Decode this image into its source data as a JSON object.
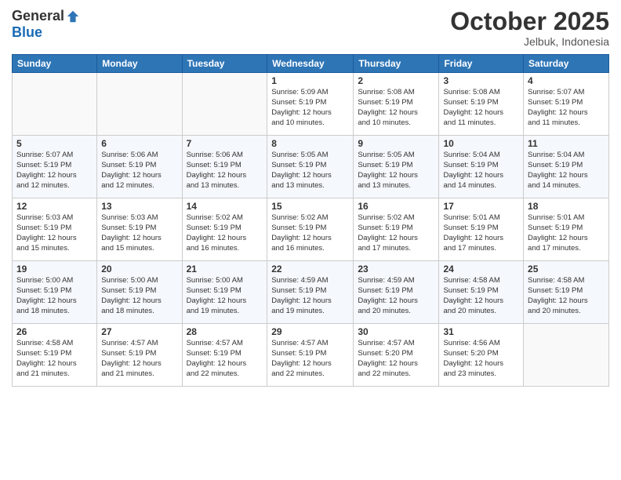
{
  "logo": {
    "general": "General",
    "blue": "Blue"
  },
  "header": {
    "month": "October 2025",
    "location": "Jelbuk, Indonesia"
  },
  "weekdays": [
    "Sunday",
    "Monday",
    "Tuesday",
    "Wednesday",
    "Thursday",
    "Friday",
    "Saturday"
  ],
  "weeks": [
    [
      {
        "day": "",
        "info": ""
      },
      {
        "day": "",
        "info": ""
      },
      {
        "day": "",
        "info": ""
      },
      {
        "day": "1",
        "info": "Sunrise: 5:09 AM\nSunset: 5:19 PM\nDaylight: 12 hours\nand 10 minutes."
      },
      {
        "day": "2",
        "info": "Sunrise: 5:08 AM\nSunset: 5:19 PM\nDaylight: 12 hours\nand 10 minutes."
      },
      {
        "day": "3",
        "info": "Sunrise: 5:08 AM\nSunset: 5:19 PM\nDaylight: 12 hours\nand 11 minutes."
      },
      {
        "day": "4",
        "info": "Sunrise: 5:07 AM\nSunset: 5:19 PM\nDaylight: 12 hours\nand 11 minutes."
      }
    ],
    [
      {
        "day": "5",
        "info": "Sunrise: 5:07 AM\nSunset: 5:19 PM\nDaylight: 12 hours\nand 12 minutes."
      },
      {
        "day": "6",
        "info": "Sunrise: 5:06 AM\nSunset: 5:19 PM\nDaylight: 12 hours\nand 12 minutes."
      },
      {
        "day": "7",
        "info": "Sunrise: 5:06 AM\nSunset: 5:19 PM\nDaylight: 12 hours\nand 13 minutes."
      },
      {
        "day": "8",
        "info": "Sunrise: 5:05 AM\nSunset: 5:19 PM\nDaylight: 12 hours\nand 13 minutes."
      },
      {
        "day": "9",
        "info": "Sunrise: 5:05 AM\nSunset: 5:19 PM\nDaylight: 12 hours\nand 13 minutes."
      },
      {
        "day": "10",
        "info": "Sunrise: 5:04 AM\nSunset: 5:19 PM\nDaylight: 12 hours\nand 14 minutes."
      },
      {
        "day": "11",
        "info": "Sunrise: 5:04 AM\nSunset: 5:19 PM\nDaylight: 12 hours\nand 14 minutes."
      }
    ],
    [
      {
        "day": "12",
        "info": "Sunrise: 5:03 AM\nSunset: 5:19 PM\nDaylight: 12 hours\nand 15 minutes."
      },
      {
        "day": "13",
        "info": "Sunrise: 5:03 AM\nSunset: 5:19 PM\nDaylight: 12 hours\nand 15 minutes."
      },
      {
        "day": "14",
        "info": "Sunrise: 5:02 AM\nSunset: 5:19 PM\nDaylight: 12 hours\nand 16 minutes."
      },
      {
        "day": "15",
        "info": "Sunrise: 5:02 AM\nSunset: 5:19 PM\nDaylight: 12 hours\nand 16 minutes."
      },
      {
        "day": "16",
        "info": "Sunrise: 5:02 AM\nSunset: 5:19 PM\nDaylight: 12 hours\nand 17 minutes."
      },
      {
        "day": "17",
        "info": "Sunrise: 5:01 AM\nSunset: 5:19 PM\nDaylight: 12 hours\nand 17 minutes."
      },
      {
        "day": "18",
        "info": "Sunrise: 5:01 AM\nSunset: 5:19 PM\nDaylight: 12 hours\nand 17 minutes."
      }
    ],
    [
      {
        "day": "19",
        "info": "Sunrise: 5:00 AM\nSunset: 5:19 PM\nDaylight: 12 hours\nand 18 minutes."
      },
      {
        "day": "20",
        "info": "Sunrise: 5:00 AM\nSunset: 5:19 PM\nDaylight: 12 hours\nand 18 minutes."
      },
      {
        "day": "21",
        "info": "Sunrise: 5:00 AM\nSunset: 5:19 PM\nDaylight: 12 hours\nand 19 minutes."
      },
      {
        "day": "22",
        "info": "Sunrise: 4:59 AM\nSunset: 5:19 PM\nDaylight: 12 hours\nand 19 minutes."
      },
      {
        "day": "23",
        "info": "Sunrise: 4:59 AM\nSunset: 5:19 PM\nDaylight: 12 hours\nand 20 minutes."
      },
      {
        "day": "24",
        "info": "Sunrise: 4:58 AM\nSunset: 5:19 PM\nDaylight: 12 hours\nand 20 minutes."
      },
      {
        "day": "25",
        "info": "Sunrise: 4:58 AM\nSunset: 5:19 PM\nDaylight: 12 hours\nand 20 minutes."
      }
    ],
    [
      {
        "day": "26",
        "info": "Sunrise: 4:58 AM\nSunset: 5:19 PM\nDaylight: 12 hours\nand 21 minutes."
      },
      {
        "day": "27",
        "info": "Sunrise: 4:57 AM\nSunset: 5:19 PM\nDaylight: 12 hours\nand 21 minutes."
      },
      {
        "day": "28",
        "info": "Sunrise: 4:57 AM\nSunset: 5:19 PM\nDaylight: 12 hours\nand 22 minutes."
      },
      {
        "day": "29",
        "info": "Sunrise: 4:57 AM\nSunset: 5:19 PM\nDaylight: 12 hours\nand 22 minutes."
      },
      {
        "day": "30",
        "info": "Sunrise: 4:57 AM\nSunset: 5:20 PM\nDaylight: 12 hours\nand 22 minutes."
      },
      {
        "day": "31",
        "info": "Sunrise: 4:56 AM\nSunset: 5:20 PM\nDaylight: 12 hours\nand 23 minutes."
      },
      {
        "day": "",
        "info": ""
      }
    ]
  ]
}
